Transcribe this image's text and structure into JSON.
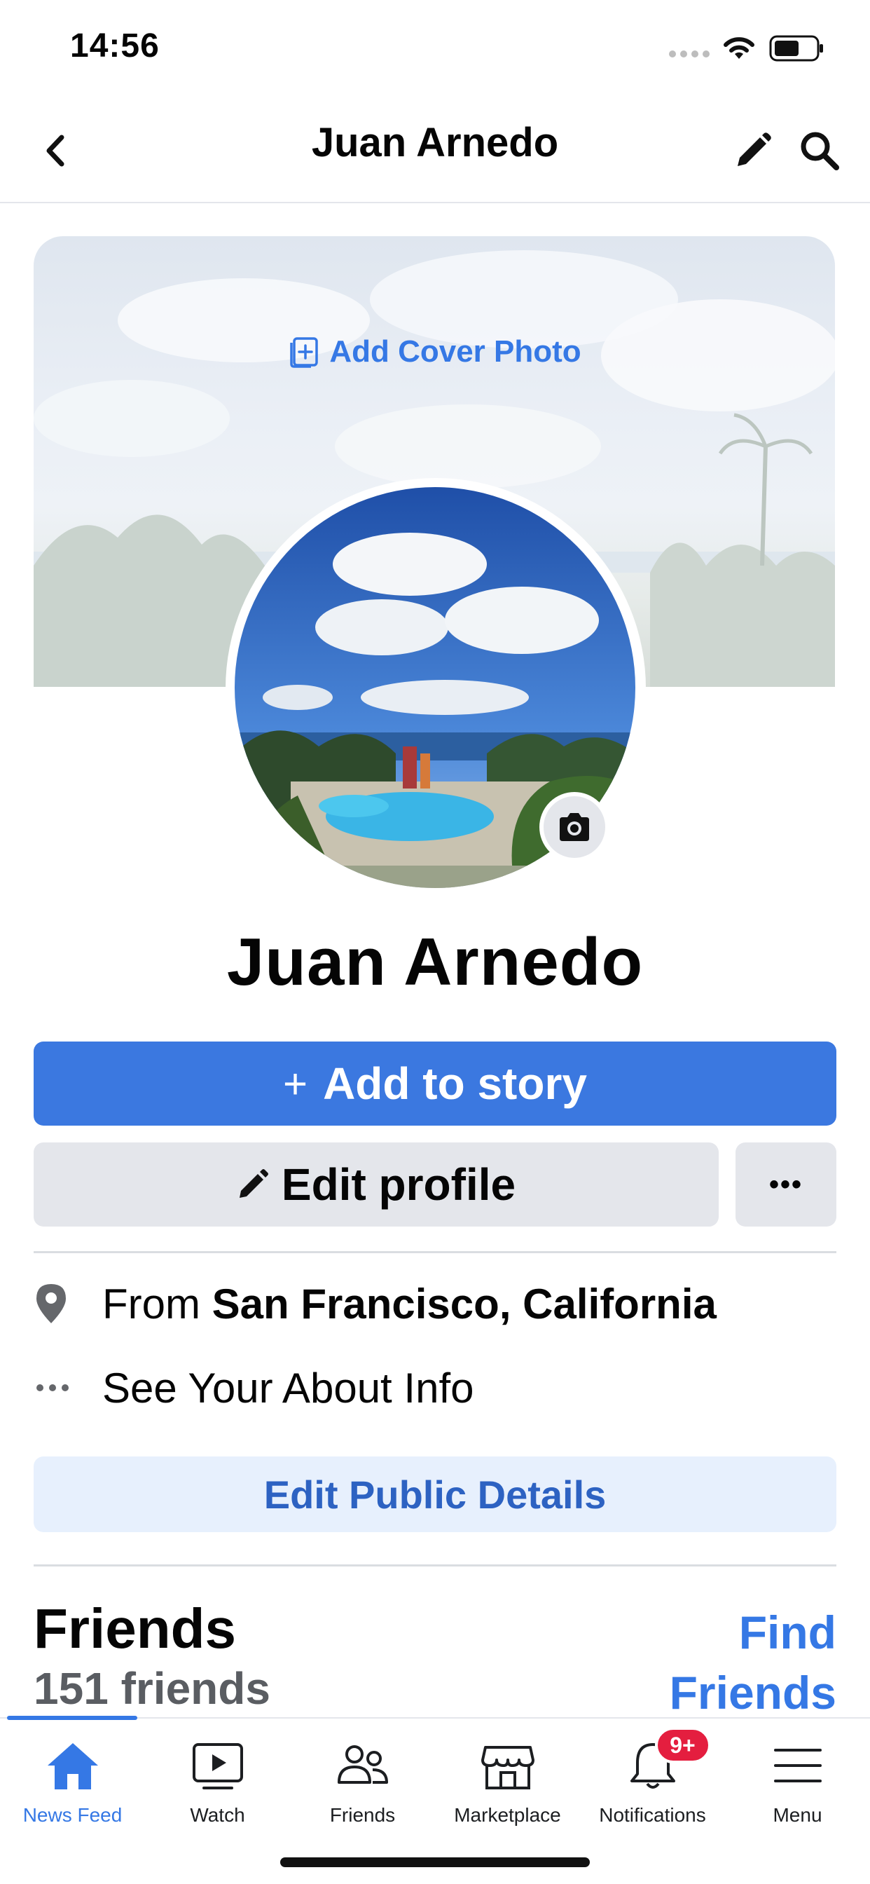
{
  "status_bar": {
    "time": "14:56"
  },
  "nav": {
    "title": "Juan Arnedo"
  },
  "cover": {
    "add_cover_label": "Add Cover Photo"
  },
  "profile": {
    "name": "Juan Arnedo"
  },
  "actions": {
    "add_story_label": "Add to story",
    "edit_profile_label": "Edit profile",
    "more_label": "•••"
  },
  "about": {
    "from_prefix": "From ",
    "hometown": "San Francisco, California",
    "see_about_label": "See Your About Info",
    "edit_public_label": "Edit Public Details"
  },
  "friends": {
    "title": "Friends",
    "count_label": "151 friends",
    "find_line1": "Find",
    "find_line2": "Friends"
  },
  "tabs": [
    {
      "label": "News Feed",
      "icon": "home-icon",
      "active": true
    },
    {
      "label": "Watch",
      "icon": "video-icon"
    },
    {
      "label": "Friends",
      "icon": "friends-icon"
    },
    {
      "label": "Marketplace",
      "icon": "store-icon"
    },
    {
      "label": "Notifications",
      "icon": "bell-icon",
      "badge": "9+"
    },
    {
      "label": "Menu",
      "icon": "hamburger-icon"
    }
  ],
  "colors": {
    "accent": "#3b78e0",
    "link": "#3578e5",
    "badge": "#e41e3f",
    "button_grey": "#e4e6eb"
  }
}
